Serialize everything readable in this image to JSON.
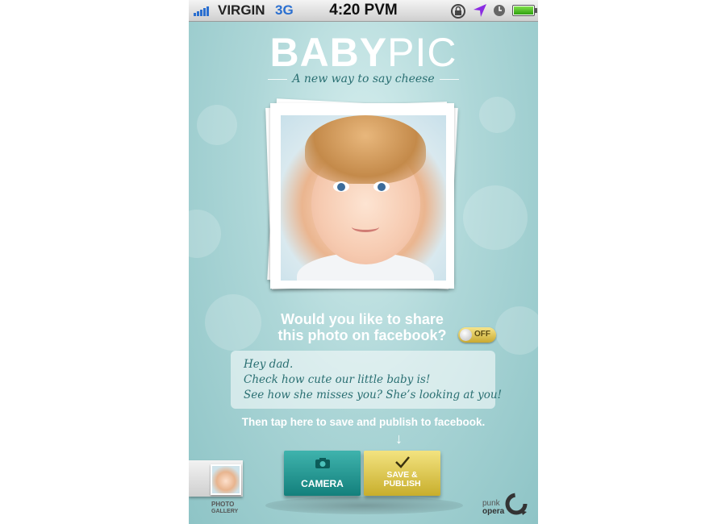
{
  "status_bar": {
    "carrier": "VIRGIN",
    "network": "3G",
    "time": "4:20 PVM"
  },
  "header": {
    "logo_bold": "BABY",
    "logo_light": "PIC",
    "tagline": "A new way to say cheese"
  },
  "share": {
    "question_line1": "Would you like to share",
    "question_line2": "this photo on facebook?",
    "toggle_label": "OFF",
    "toggle_state": "off"
  },
  "message": {
    "lines": [
      "Hey dad.",
      "Check how cute our little baby is!",
      "See how she misses you? She’s looking at you!"
    ]
  },
  "instruction": "Then tap here to save and publish to facebook.",
  "buttons": {
    "camera_label": "CAMERA",
    "save_line1": "SAVE &",
    "save_line2": "PUBLISH"
  },
  "gallery": {
    "label_line1": "PHOTO",
    "label_line2": "GALLERY"
  },
  "brand": {
    "line1": "punk",
    "line2": "opera"
  },
  "colors": {
    "accent_teal": "#13807c",
    "accent_gold": "#c8ae2c",
    "text_teal": "#2a6f72"
  },
  "icons": [
    "signal-icon",
    "rotation-lock-icon",
    "location-icon",
    "clock-icon",
    "battery-icon",
    "camera-icon",
    "checkmark-icon",
    "arrow-down-icon",
    "punk-opera-logo-icon"
  ]
}
